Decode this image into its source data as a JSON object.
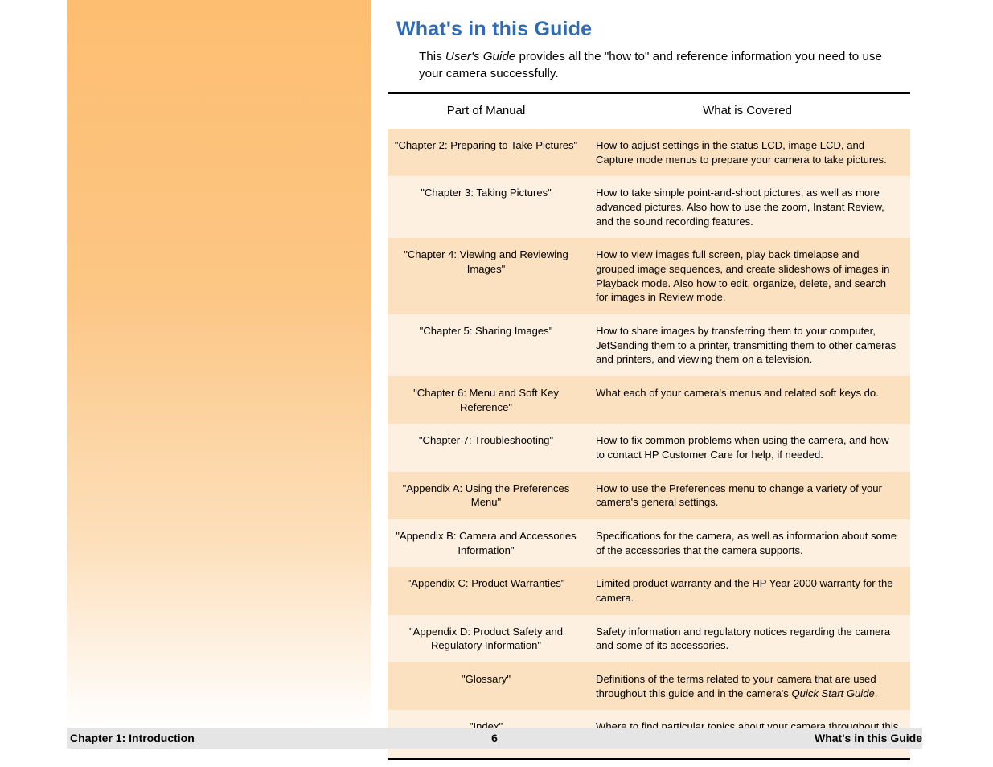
{
  "heading": "What's in this Guide",
  "intro_prefix": "This ",
  "intro_italic": "User's Guide",
  "intro_suffix": "  provides all the \"how to\" and reference information you need to use your camera successfully.",
  "columns": [
    "Part of Manual",
    "What is Covered"
  ],
  "rows": [
    {
      "part": "\"Chapter 2: Preparing to Take Pictures\"",
      "cov": "How to adjust settings in the status LCD, image LCD, and Capture mode menus to prepare your camera to take pictures."
    },
    {
      "part": "\"Chapter 3: Taking Pictures\"",
      "cov": "How to take simple point-and-shoot pictures, as well as more advanced pictures. Also how to use the zoom, Instant Review, and the sound recording features."
    },
    {
      "part": "\"Chapter 4: Viewing and Reviewing Images\"",
      "cov": "How to view images full screen, play back timelapse and grouped image sequences, and create slideshows of images in Playback mode. Also how to edit, organize, delete, and search for images in Review mode."
    },
    {
      "part": "\"Chapter 5: Sharing Images\"",
      "cov": "How to share images by transferring them to your computer, JetSending them to a printer, transmitting them to other cameras and printers, and viewing them on a television."
    },
    {
      "part": "\"Chapter 6: Menu and Soft Key Reference\"",
      "cov": "What each of your camera's menus and related soft keys do."
    },
    {
      "part": "\"Chapter 7: Troubleshooting\"",
      "cov": "How to fix common problems when using the camera, and how to contact HP Customer Care for help, if needed."
    },
    {
      "part": "\"Appendix A: Using the Preferences Menu\"",
      "cov": "How to use the Preferences menu to change a variety of your camera's general settings."
    },
    {
      "part": "\"Appendix B: Camera and Accessories Information\"",
      "cov": "Specifications for the camera, as well as information about some of the accessories that the camera supports."
    },
    {
      "part": "\"Appendix C: Product Warranties\"",
      "cov": "Limited product warranty and the HP Year 2000 warranty for the camera."
    },
    {
      "part": "\"Appendix D: Product Safety and Regulatory Information\"",
      "cov": "Safety information and regulatory notices regarding the camera and some of its accessories."
    },
    {
      "part": "\"Glossary\"",
      "cov_prefix": "Definitions of the terms related to your camera that are used throughout this guide and in the camera's ",
      "cov_italic": "Quick Start Guide",
      "cov_suffix": "."
    },
    {
      "part": "\"Index\"",
      "cov": "Where to find particular topics about your camera throughout this guide."
    }
  ],
  "footer": {
    "left": "Chapter 1: Introduction",
    "center": "6",
    "right": "What's in this Guide"
  }
}
